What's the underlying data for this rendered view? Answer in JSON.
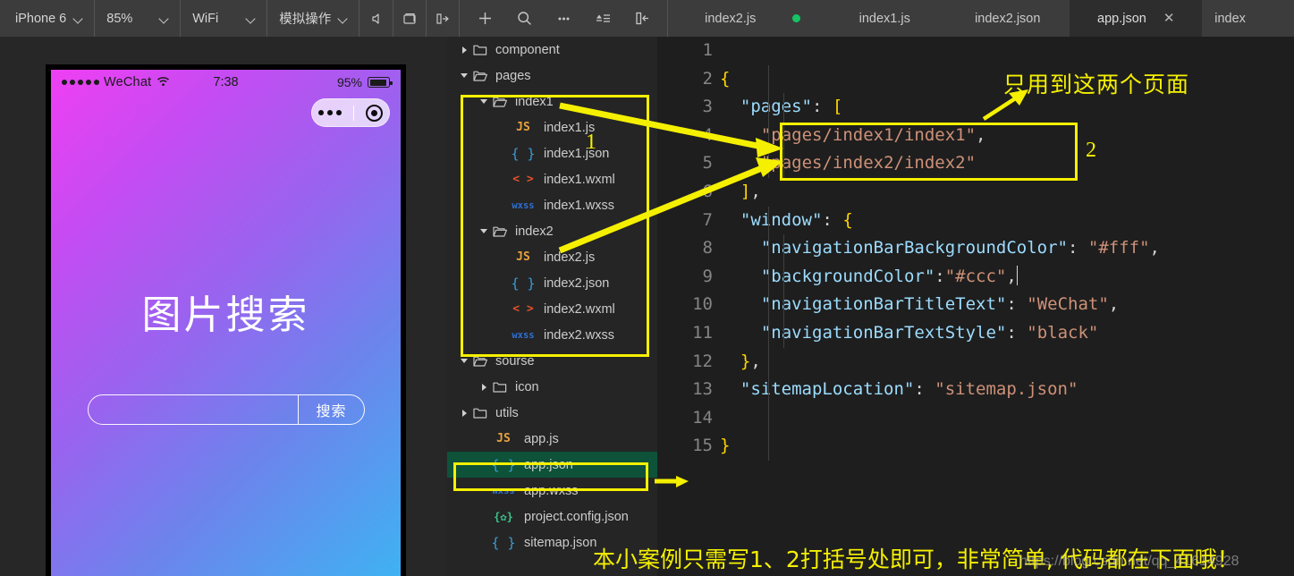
{
  "toolbar": {
    "device": "iPhone 6",
    "zoom": "85%",
    "network": "WiFi",
    "simulate": "模拟操作",
    "icons": [
      "volume-icon",
      "screen-icon",
      "panel-toggle-icon",
      "add-icon",
      "search-icon",
      "more-icon",
      "compile-icon",
      "layout-icon"
    ]
  },
  "tabs": [
    {
      "label": "index2.js",
      "modified": true,
      "active": false,
      "closable": false
    },
    {
      "label": "index1.js",
      "modified": false,
      "active": false,
      "closable": false
    },
    {
      "label": "index2.json",
      "modified": false,
      "active": false,
      "closable": false
    },
    {
      "label": "app.json",
      "modified": false,
      "active": true,
      "closable": true,
      "close": "✕"
    },
    {
      "label": "index",
      "modified": false,
      "active": false,
      "closable": false
    }
  ],
  "simulator": {
    "status": {
      "carrier": "WeChat",
      "time": "7:38",
      "battery_pct": "95%"
    },
    "page": {
      "title": "图片搜索",
      "search_value": "",
      "search_placeholder": "",
      "search_button": "搜索"
    }
  },
  "tree": [
    {
      "label": "component",
      "depth": 0,
      "type": "folder",
      "state": "collapsed",
      "icon": "folder-icon"
    },
    {
      "label": "pages",
      "depth": 0,
      "type": "folder",
      "state": "expanded",
      "icon": "folder-open-icon"
    },
    {
      "label": "index1",
      "depth": 1,
      "type": "folder",
      "state": "expanded",
      "icon": "folder-open-icon"
    },
    {
      "label": "index1.js",
      "depth": 2,
      "type": "file",
      "ext": "js",
      "badge": "JS"
    },
    {
      "label": "index1.json",
      "depth": 2,
      "type": "file",
      "ext": "json",
      "badge": "{ }"
    },
    {
      "label": "index1.wxml",
      "depth": 2,
      "type": "file",
      "ext": "wxml",
      "badge": "< >"
    },
    {
      "label": "index1.wxss",
      "depth": 2,
      "type": "file",
      "ext": "wxss",
      "badge": "wxss"
    },
    {
      "label": "index2",
      "depth": 1,
      "type": "folder",
      "state": "expanded",
      "icon": "folder-open-icon"
    },
    {
      "label": "index2.js",
      "depth": 2,
      "type": "file",
      "ext": "js",
      "badge": "JS"
    },
    {
      "label": "index2.json",
      "depth": 2,
      "type": "file",
      "ext": "json",
      "badge": "{ }"
    },
    {
      "label": "index2.wxml",
      "depth": 2,
      "type": "file",
      "ext": "wxml",
      "badge": "< >"
    },
    {
      "label": "index2.wxss",
      "depth": 2,
      "type": "file",
      "ext": "wxss",
      "badge": "wxss"
    },
    {
      "label": "sourse",
      "depth": 0,
      "type": "folder",
      "state": "expanded",
      "icon": "folder-open-icon"
    },
    {
      "label": "icon",
      "depth": 1,
      "type": "folder",
      "state": "collapsed",
      "icon": "folder-icon"
    },
    {
      "label": "utils",
      "depth": 0,
      "type": "folder",
      "state": "collapsed",
      "icon": "folder-icon"
    },
    {
      "label": "app.js",
      "depth": 1,
      "type": "file",
      "ext": "js",
      "badge": "JS"
    },
    {
      "label": "app.json",
      "depth": 1,
      "type": "file",
      "ext": "json",
      "badge": "{ }",
      "selected": true
    },
    {
      "label": "app.wxss",
      "depth": 1,
      "type": "file",
      "ext": "wxss",
      "badge": "wxss"
    },
    {
      "label": "project.config.json",
      "depth": 1,
      "type": "file",
      "ext": "cfg",
      "badge": "{✿}"
    },
    {
      "label": "sitemap.json",
      "depth": 1,
      "type": "file",
      "ext": "json",
      "badge": "{ }"
    }
  ],
  "editor": {
    "filename": "app.json",
    "lines": [
      {
        "n": "1",
        "text": ""
      },
      {
        "n": "2",
        "text": "{"
      },
      {
        "n": "3",
        "text": "  \"pages\": ["
      },
      {
        "n": "4",
        "text": "    \"pages/index1/index1\","
      },
      {
        "n": "5",
        "text": "    \"pages/index2/index2\""
      },
      {
        "n": "6",
        "text": "  ],"
      },
      {
        "n": "7",
        "text": "  \"window\": {"
      },
      {
        "n": "8",
        "text": "    \"navigationBarBackgroundColor\": \"#fff\","
      },
      {
        "n": "9",
        "text": "    \"backgroundColor\":\"#ccc\","
      },
      {
        "n": "10",
        "text": "    \"navigationBarTitleText\": \"WeChat\","
      },
      {
        "n": "11",
        "text": "    \"navigationBarTextStyle\": \"black\""
      },
      {
        "n": "12",
        "text": "  },"
      },
      {
        "n": "13",
        "text": "  \"sitemapLocation\": \"sitemap.json\""
      },
      {
        "n": "14",
        "text": ""
      },
      {
        "n": "15",
        "text": "}"
      }
    ]
  },
  "annotations": {
    "note_top": "只用到这两个页面",
    "label_1": "1",
    "label_2": "2",
    "note_bottom": "本小案例只需写1、2打括号处即可，非常简单, 代码都在下面哦！",
    "watermark": "https://blog.csdn.net/qq_41614928",
    "highlight_color": "#f5f000"
  }
}
